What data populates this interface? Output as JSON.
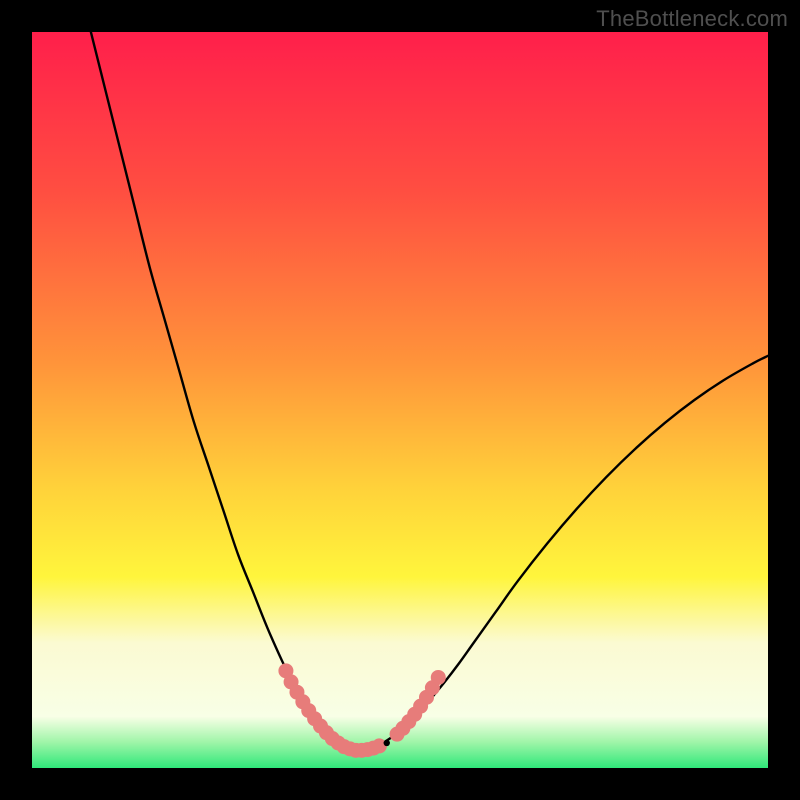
{
  "watermark": "TheBottleneck.com",
  "colors": {
    "background": "#000000",
    "strip_ivory": "#fbfad2",
    "strip_green": "#2fe87a",
    "curve": "#000000",
    "marker_fill": "#e77c7a",
    "marker_stroke": "#b95552"
  },
  "chart_data": {
    "type": "line",
    "title": "",
    "xlabel": "",
    "ylabel": "",
    "xlim": [
      0,
      100
    ],
    "ylim": [
      0,
      100
    ],
    "grid": false,
    "legend": false,
    "gradient_stops": [
      {
        "offset": 0.0,
        "color": "#ff1f4b"
      },
      {
        "offset": 0.22,
        "color": "#ff4f41"
      },
      {
        "offset": 0.45,
        "color": "#ff943a"
      },
      {
        "offset": 0.62,
        "color": "#ffd23a"
      },
      {
        "offset": 0.74,
        "color": "#fff53c"
      },
      {
        "offset": 0.83,
        "color": "#fbfad2"
      },
      {
        "offset": 0.93,
        "color": "#f8ffe6"
      },
      {
        "offset": 0.965,
        "color": "#9ff5a8"
      },
      {
        "offset": 1.0,
        "color": "#2fe87a"
      }
    ],
    "series": [
      {
        "name": "left-branch",
        "x": [
          8,
          10,
          12,
          14,
          16,
          18,
          20,
          22,
          24,
          26,
          28,
          30,
          32,
          34,
          35,
          36,
          37,
          38,
          39,
          40,
          41,
          42
        ],
        "y": [
          100,
          92,
          84,
          76,
          68,
          61,
          54,
          47,
          41,
          35,
          29,
          24,
          19,
          14.5,
          12.5,
          10.5,
          8.7,
          7.1,
          5.7,
          4.5,
          3.6,
          3.0
        ]
      },
      {
        "name": "valley-floor",
        "x": [
          42,
          43,
          44,
          45,
          46,
          47,
          48
        ],
        "y": [
          3.0,
          2.6,
          2.4,
          2.4,
          2.6,
          3.0,
          3.6
        ]
      },
      {
        "name": "right-branch",
        "x": [
          48,
          50,
          52,
          54,
          56,
          58,
          60,
          63,
          66,
          70,
          74,
          78,
          82,
          86,
          90,
          94,
          98,
          100
        ],
        "y": [
          3.6,
          5.0,
          7.0,
          9.2,
          11.6,
          14.2,
          17.0,
          21.2,
          25.4,
          30.5,
          35.2,
          39.5,
          43.4,
          46.9,
          50.0,
          52.7,
          55.0,
          56.0
        ]
      }
    ],
    "markers": [
      {
        "name": "left-markers",
        "points": [
          {
            "x": 34.5,
            "y": 13.2
          },
          {
            "x": 35.2,
            "y": 11.7
          },
          {
            "x": 36.0,
            "y": 10.3
          },
          {
            "x": 36.8,
            "y": 9.0
          },
          {
            "x": 37.6,
            "y": 7.8
          },
          {
            "x": 38.4,
            "y": 6.7
          },
          {
            "x": 39.2,
            "y": 5.7
          },
          {
            "x": 40.0,
            "y": 4.8
          },
          {
            "x": 40.8,
            "y": 4.0
          },
          {
            "x": 41.6,
            "y": 3.4
          }
        ]
      },
      {
        "name": "floor-markers",
        "points": [
          {
            "x": 42.4,
            "y": 2.9
          },
          {
            "x": 43.2,
            "y": 2.6
          },
          {
            "x": 44.0,
            "y": 2.4
          },
          {
            "x": 44.8,
            "y": 2.4
          },
          {
            "x": 45.6,
            "y": 2.5
          },
          {
            "x": 46.4,
            "y": 2.7
          },
          {
            "x": 47.2,
            "y": 3.0
          }
        ]
      },
      {
        "name": "right-markers",
        "points": [
          {
            "x": 49.6,
            "y": 4.6
          },
          {
            "x": 50.4,
            "y": 5.4
          },
          {
            "x": 51.2,
            "y": 6.3
          },
          {
            "x": 52.0,
            "y": 7.3
          },
          {
            "x": 52.8,
            "y": 8.4
          },
          {
            "x": 53.6,
            "y": 9.6
          },
          {
            "x": 54.4,
            "y": 10.9
          },
          {
            "x": 55.2,
            "y": 12.3
          }
        ]
      }
    ],
    "single_dark_marker": {
      "x": 48.2,
      "y": 3.4
    }
  }
}
